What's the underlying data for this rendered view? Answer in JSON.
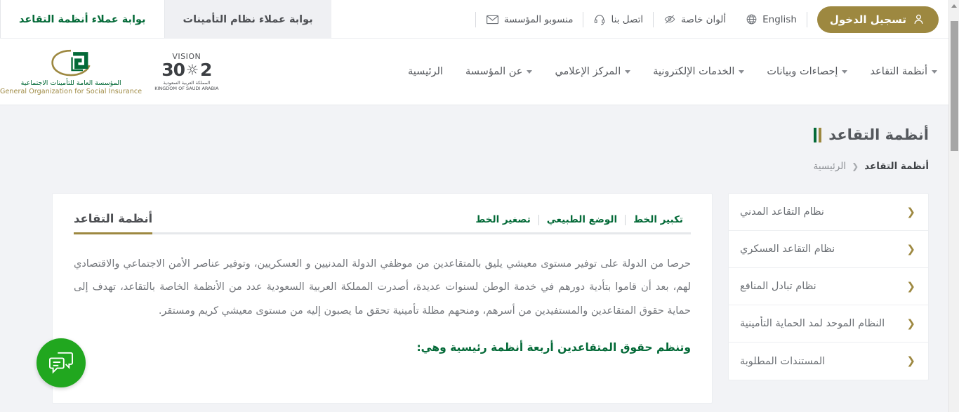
{
  "topbar": {
    "portal_tabs": [
      {
        "label": "بوابة عملاء أنظمة التقاعد",
        "active": true
      },
      {
        "label": "بوابة عملاء نظام التأمينات",
        "active": false
      }
    ],
    "login_label": "تسجيل الدخول",
    "util_items": [
      {
        "label": "English",
        "icon": "globe-icon"
      },
      {
        "label": "ألوان خاصة",
        "icon": "eye-slash-icon"
      },
      {
        "label": "اتصل بنا",
        "icon": "headset-icon"
      },
      {
        "label": "منسوبو المؤسسة",
        "icon": "envelope-icon"
      }
    ]
  },
  "brand": {
    "gosi_arabic": "المؤسسة العامة للتأمينات الاجتماعية",
    "gosi_english": "General Organization for Social Insurance",
    "vision_top": "VISION",
    "vision_number_left": "2",
    "vision_number_right": "30",
    "vision_sub_ar": "المملكة العربية السعودية",
    "vision_sub_en": "KINGDOM OF SAUDI ARABIA"
  },
  "nav": {
    "items": [
      {
        "label": "الرئيسية",
        "has_caret": false
      },
      {
        "label": "عن المؤسسة",
        "has_caret": true
      },
      {
        "label": "المركز الإعلامي",
        "has_caret": true
      },
      {
        "label": "الخدمات الإلكترونية",
        "has_caret": true
      },
      {
        "label": "إحصاءات وبيانات",
        "has_caret": true
      },
      {
        "label": "أنظمة التقاعد",
        "has_caret": true
      }
    ]
  },
  "page": {
    "title": "أنظمة التقاعد",
    "breadcrumb_home": "الرئيسية",
    "breadcrumb_sep": "❮",
    "breadcrumb_current": "أنظمة التقاعد"
  },
  "sidebar": {
    "items": [
      {
        "label": "نظام التقاعد المدني"
      },
      {
        "label": "نظام التقاعد العسكري"
      },
      {
        "label": "نظام تبادل المنافع"
      },
      {
        "label": "النظام الموحد لمد الحماية التأمينية"
      },
      {
        "label": "المستندات المطلوبة"
      }
    ],
    "chevron": "❮"
  },
  "card": {
    "title": "أنظمة التقاعد",
    "font_tools": [
      {
        "label": "تكبير الخط"
      },
      {
        "label": "الوضع الطبيعي"
      },
      {
        "label": "تصغير الخط"
      }
    ],
    "paragraph": "حرصا من الدولة على توفير مستوى معيشي يليق بالمتقاعدين من موظفي الدولة المدنيين و العسكريين، وتوفير عناصر الأمن الاجتماعي والاقتصادي لهم، بعد أن قاموا بتأدية دورهم في خدمة الوطن لسنوات عديدة، أصدرت المملكة العربية السعودية عدد من الأنظمة الخاصة بالتقاعد، تهدف إلى حماية حقوق المتقاعدين والمستفيدين من أسرهم، ومنحهم مظلة تأمينية تحقق ما يصبون إليه من مستوى معيشي كريم ومستقر.",
    "subheading": "وتنظم حقوق المتقاعدين أربعة أنظمة رئيسية وهي:"
  },
  "chat": {
    "icon": "chat-bubbles-icon"
  },
  "colors": {
    "green": "#046a38",
    "gold": "#9d8840",
    "chat_green": "#21a71f",
    "page_bg": "#f2f3f6",
    "text_gray": "#75787d"
  }
}
